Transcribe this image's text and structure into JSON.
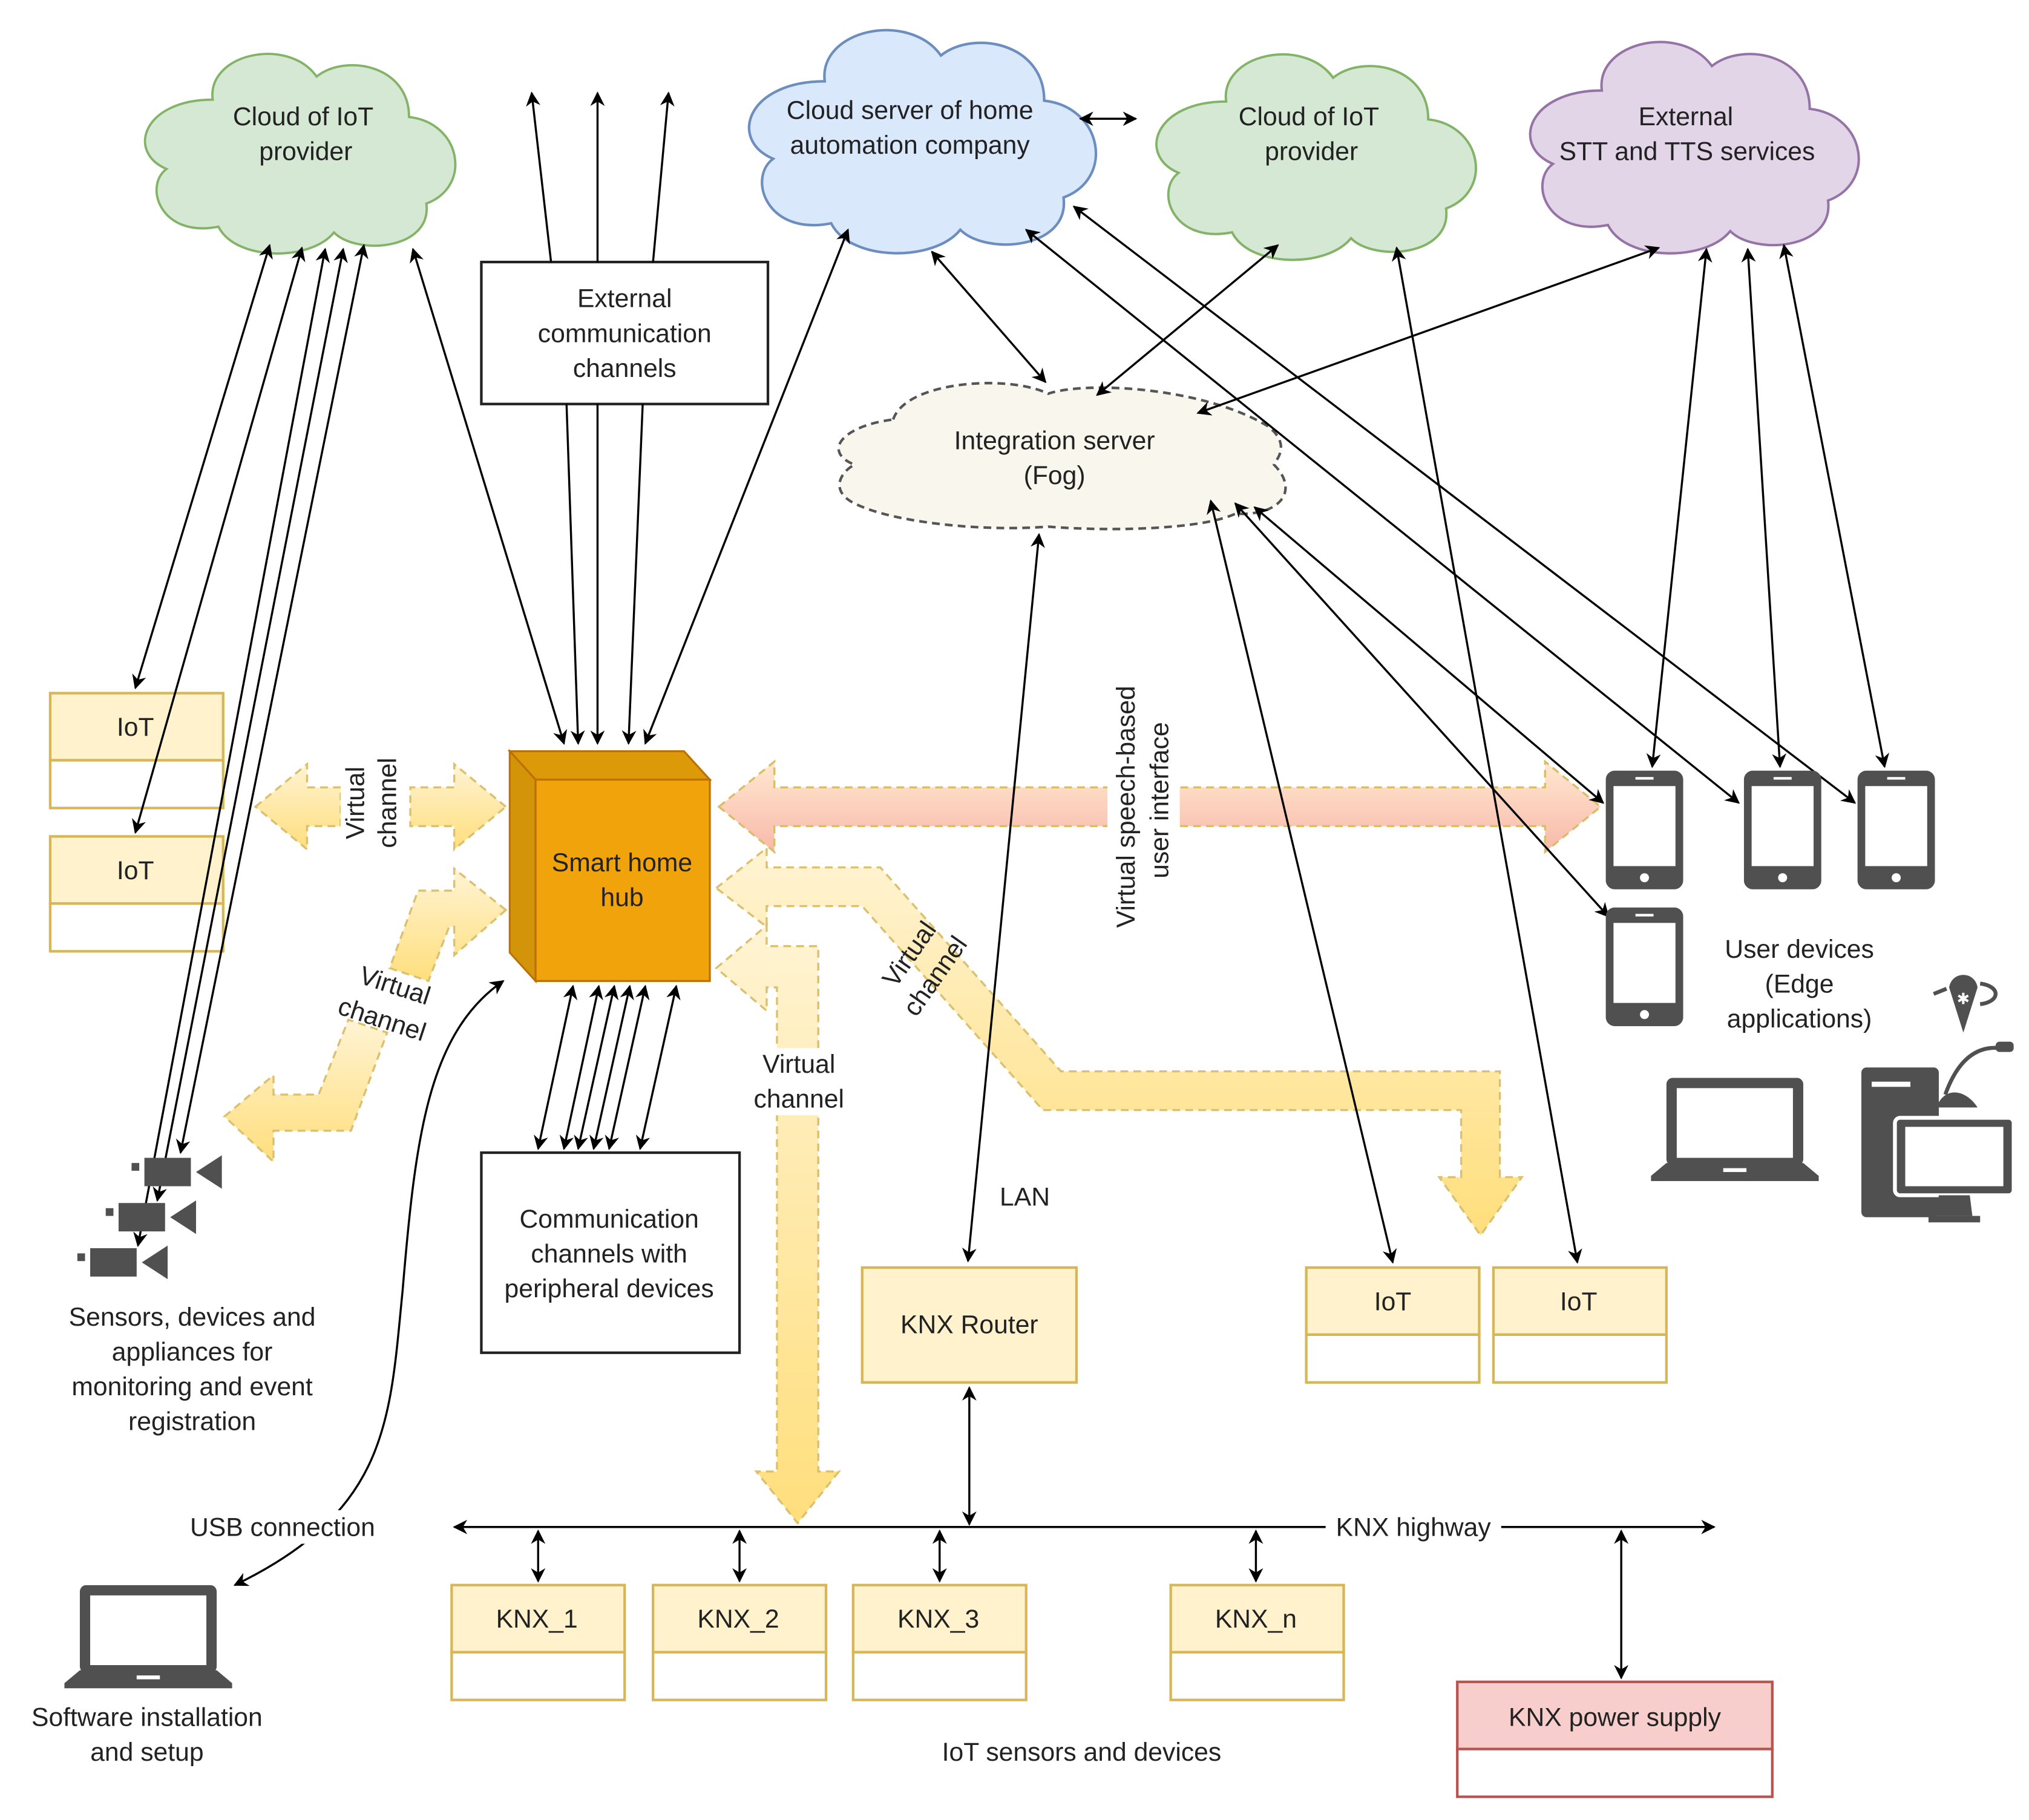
{
  "clouds": {
    "iot_provider_left": {
      "line1": "Cloud of IoT",
      "line2": "provider"
    },
    "home_automation": {
      "line1": "Cloud server of home",
      "line2": "automation company"
    },
    "iot_provider_right": {
      "line1": "Cloud of IoT",
      "line2": "provider"
    },
    "stt_tts": {
      "line1": "External",
      "line2": "STT and  TTS services"
    },
    "integration": {
      "line1": "Integration server",
      "line2": "(Fog)"
    }
  },
  "boxes": {
    "external_channels": {
      "line1": "External",
      "line2": "communication",
      "line3": "channels"
    },
    "peripheral_channels": {
      "line1": "Communication",
      "line2": "channels with",
      "line3": "peripheral devices"
    },
    "hub": {
      "line1": "Smart home",
      "line2": "hub"
    },
    "knx_router": "KNX Router",
    "knx_power": "KNX power supply",
    "iot_left": [
      "IoT",
      "IoT"
    ],
    "iot_right": [
      "IoT",
      "IoT"
    ],
    "knx_devices": [
      "KNX_1",
      "KNX_2",
      "KNX_3",
      "KNX_n"
    ]
  },
  "labels": {
    "virtual_channel_1": "Virtual",
    "virtual_channel_2": "channel",
    "speech_ui_1": "Virtual speech-based",
    "speech_ui_2": "user interface",
    "lan": "LAN",
    "knx_highway": "KNX highway",
    "usb": "USB connection",
    "sensors": [
      "Sensors, devices and",
      "appliances for",
      "monitoring and event",
      "registration"
    ],
    "software": [
      "Software installation",
      "and setup"
    ],
    "user_devices": [
      "User devices",
      "(Edge",
      "applications)"
    ],
    "iot_sensors": "IoT sensors and devices"
  },
  "icons": [
    "cloud-icon",
    "smartphone-icon",
    "laptop-icon",
    "desktop-computer-icon",
    "microphone-icon",
    "bluetooth-headset-icon",
    "camera-icon"
  ],
  "colors": {
    "green_cloud": "#d5e8d4",
    "blue_cloud": "#dae8fc",
    "purple_cloud": "#e1d5e7",
    "fog_cloud": "#f9f7ed",
    "hub": "#f0a30a",
    "iot_box": "#fff2cc",
    "power_box": "#f8cecc"
  }
}
